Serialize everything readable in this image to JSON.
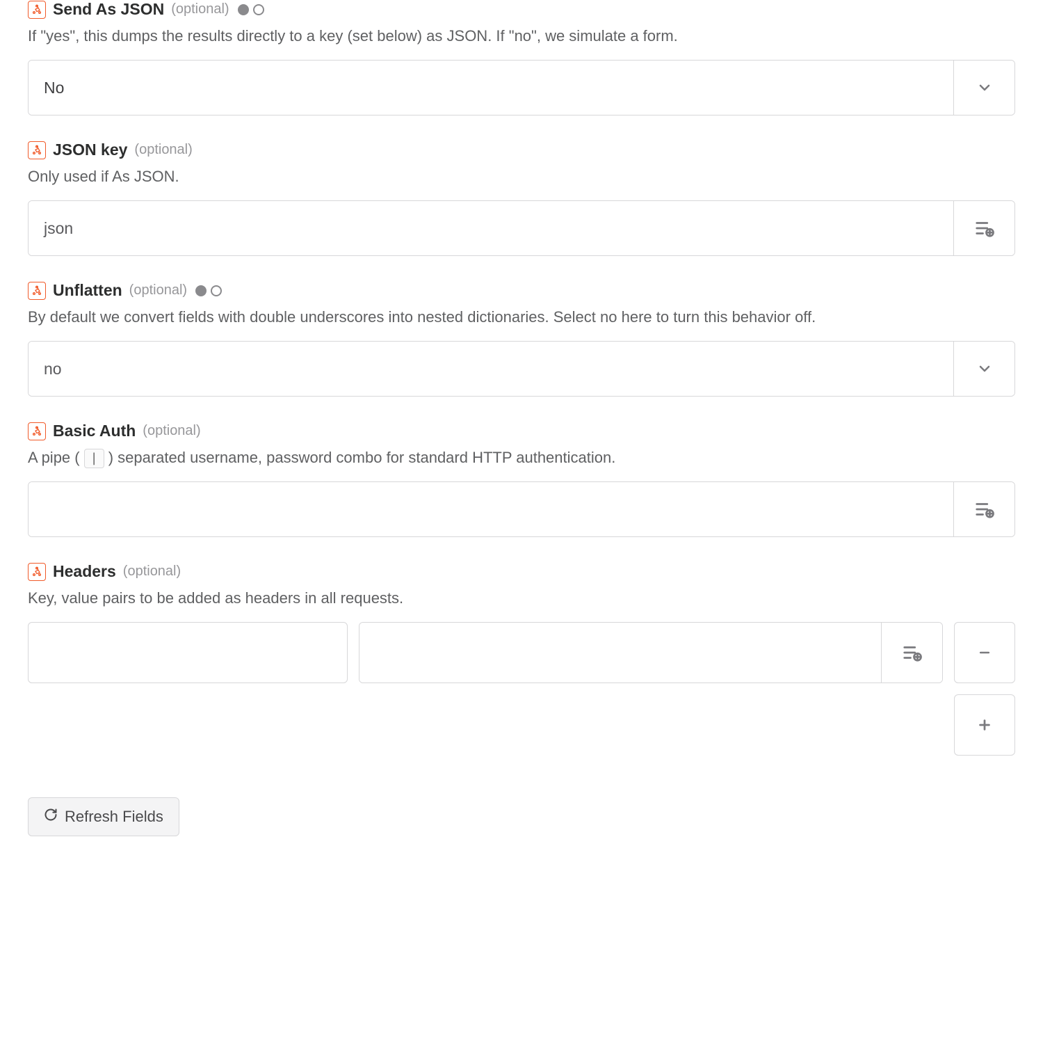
{
  "fields": {
    "send_as_json": {
      "label": "Send As JSON",
      "optional": "(optional)",
      "desc": "If \"yes\", this dumps the results directly to a key (set below) as JSON. If \"no\", we simulate a form.",
      "value": "No"
    },
    "json_key": {
      "label": "JSON key",
      "optional": "(optional)",
      "desc": "Only used if As JSON.",
      "value": "json"
    },
    "unflatten": {
      "label": "Unflatten",
      "optional": "(optional)",
      "desc": "By default we convert fields with double underscores into nested dictionaries. Select no here to turn this behavior off.",
      "value": "no"
    },
    "basic_auth": {
      "label": "Basic Auth",
      "optional": "(optional)",
      "desc_pre": "A pipe (",
      "desc_pipe": "|",
      "desc_post": ") separated username, password combo for standard HTTP authentication.",
      "value": ""
    },
    "headers": {
      "label": "Headers",
      "optional": "(optional)",
      "desc": "Key, value pairs to be added as headers in all requests.",
      "rows": [
        {
          "key": "",
          "value": ""
        }
      ]
    }
  },
  "buttons": {
    "refresh": "Refresh Fields"
  }
}
